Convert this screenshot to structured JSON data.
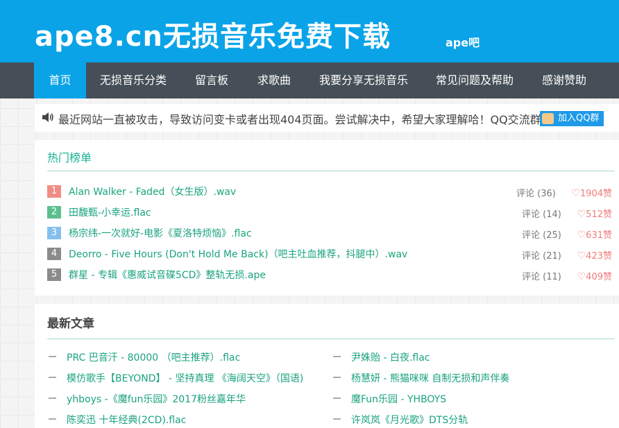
{
  "header": {
    "title": "ape8.cn无损音乐免费下载",
    "subtitle": "ape吧"
  },
  "nav": {
    "items": [
      {
        "label": "首页"
      },
      {
        "label": "无损音乐分类"
      },
      {
        "label": "留言板"
      },
      {
        "label": "求歌曲"
      },
      {
        "label": "我要分享无损音乐"
      },
      {
        "label": "常见问题及帮助"
      },
      {
        "label": "感谢赞助"
      }
    ]
  },
  "notice": {
    "text": "最近网站一直被攻击，导致访问变卡或者出现404页面。尝试解决中，希望大家理解哈！QQ交流群",
    "qq_button": "加入QQ群",
    "icon": "speaker-icon"
  },
  "hot": {
    "title": "热门榜单",
    "rank_colors": [
      "#f08c84",
      "#5cbf8f",
      "#84c0ee",
      "#8b8b8b",
      "#8b8b8b"
    ],
    "items": [
      {
        "rank": "1",
        "title": "Alan Walker - Faded（女生版）.wav",
        "comments": "评论 (36)",
        "likes": "1904赞"
      },
      {
        "rank": "2",
        "title": "田馥甄-小幸运.flac",
        "comments": "评论 (14)",
        "likes": "512赞"
      },
      {
        "rank": "3",
        "title": "杨宗纬-一次就好-电影《夏洛特烦恼》.flac",
        "comments": "评论 (25)",
        "likes": "631赞"
      },
      {
        "rank": "4",
        "title": "Deorro - Five Hours (Don't Hold Me Back)（吧主吐血推荐，抖腿中）.wav",
        "comments": "评论 (21)",
        "likes": "423赞"
      },
      {
        "rank": "5",
        "title": "群星 - 专辑《惠威试音碟5CD》整轨无损.ape",
        "comments": "评论 (11)",
        "likes": "409赞"
      }
    ]
  },
  "latest": {
    "title": "最新文章",
    "left": [
      {
        "title": "PRC 巴音汗 - 80000 （吧主推荐）.flac"
      },
      {
        "title": "模仿歌手【BEYOND】 - 坚持真理 《海阔天空》（国语)"
      },
      {
        "title": "yhboys -《魔fun乐园》2017粉丝嘉年华"
      },
      {
        "title": "陈奕迅 十年经典(2CD).flac"
      }
    ],
    "right": [
      {
        "title": "尹姝贻 - 白夜.flac"
      },
      {
        "title": "杨慧妍 - 熊猫咪咪 自制无损和声伴奏"
      },
      {
        "title": "魔Fun乐园 - YHBOYS"
      },
      {
        "title": "许岚岚《月光歌》DTS分轨"
      }
    ]
  },
  "colors": {
    "header_bg": "#0aa3e8",
    "nav_bg": "#464f58",
    "link_green": "#1aa37e",
    "like_red": "#f07c7c"
  }
}
